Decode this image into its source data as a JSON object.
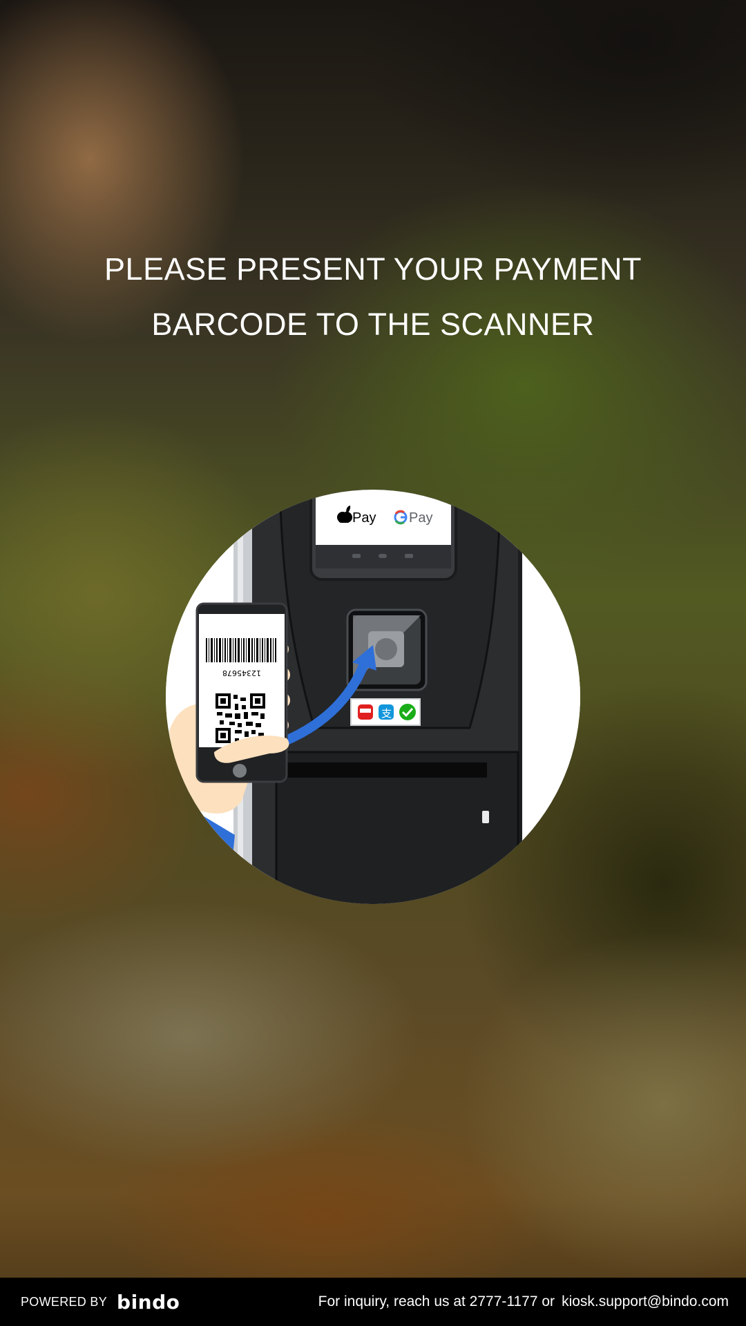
{
  "headline": {
    "line1": "PLEASE PRESENT YOUR PAYMENT",
    "line2": "BARCODE TO THE SCANNER"
  },
  "illustration": {
    "phone_barcode_number": "12345678",
    "apple_pay_label": "Pay",
    "google_pay_label": "Pay",
    "icons": [
      "apple-pay-icon",
      "google-pay-icon",
      "payment-app-red-icon",
      "alipay-icon",
      "wechat-pay-icon",
      "arrow-icon",
      "hand-icon",
      "qr-code-icon",
      "barcode-icon"
    ],
    "colors": {
      "kiosk_body": "#2b2d2f",
      "arrow": "#2f6fd8",
      "alipay": "#1296db",
      "wechat": "#1aad19",
      "red_app": "#e02020"
    }
  },
  "footer": {
    "powered_by": "POWERED BY",
    "brand": "bindo",
    "inquiry_text": "For inquiry, reach us at 2777-1177 or",
    "email": "kiosk.support@bindo.com"
  }
}
